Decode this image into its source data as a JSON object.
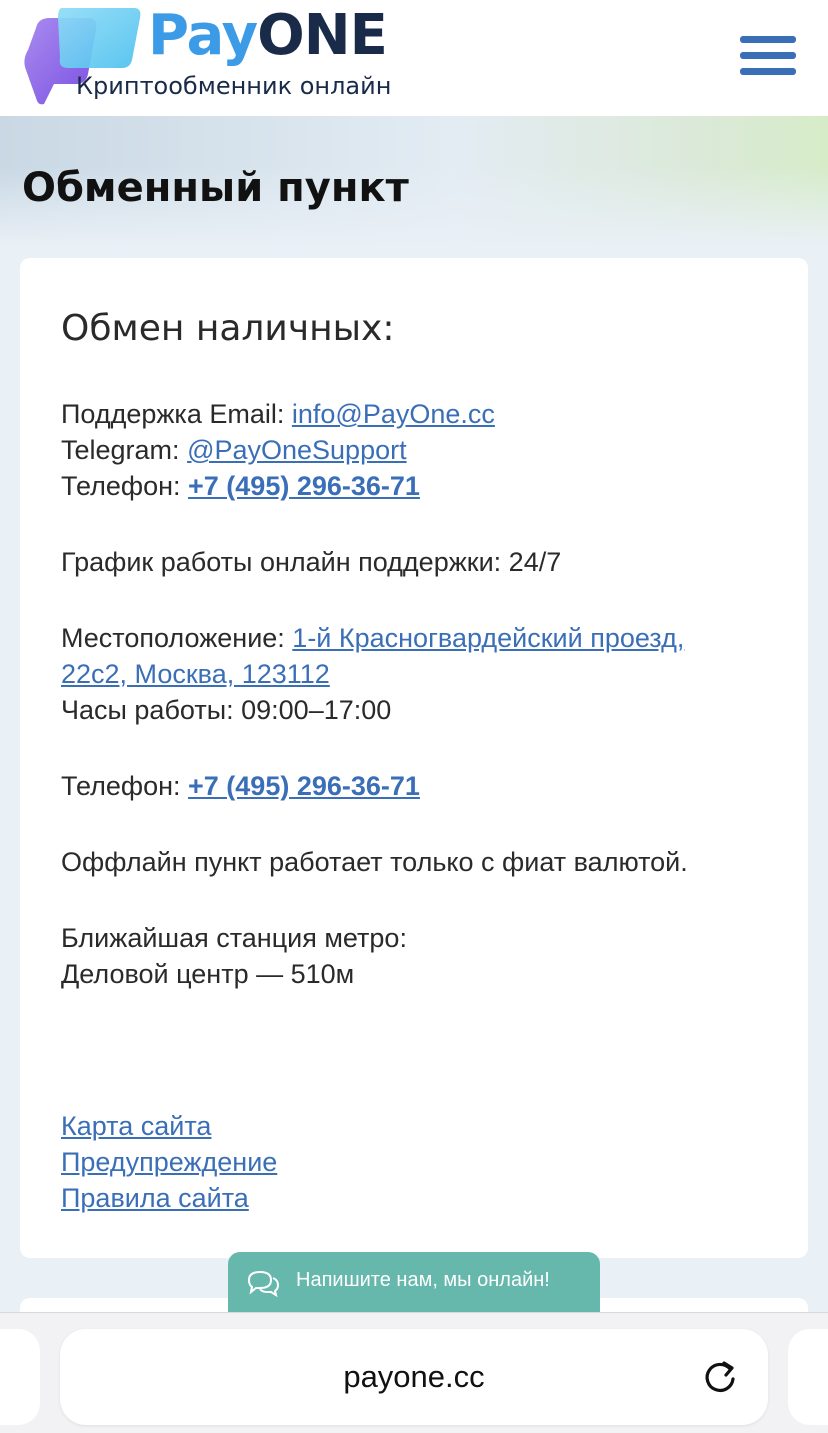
{
  "header": {
    "brand_pay": "Pay",
    "brand_one": "ONE",
    "subtitle": "Криптообменник онлайн",
    "menu_icon": "hamburger-menu-icon"
  },
  "page": {
    "title": "Обменный пункт"
  },
  "card": {
    "title": "Обмен наличных:",
    "support_email_label": "Поддержка Email: ",
    "support_email": "info@PayOne.cc",
    "telegram_label": "Telegram: ",
    "telegram": "@PayOneSupport",
    "phone_label": "Телефон: ",
    "phone": "+7 (495) 296-36-71",
    "schedule_text": "График работы онлайн поддержки: 24/7",
    "location_label": "Местоположение: ",
    "location_line1": "1-й Красногвардейский проезд,",
    "location_line2": "22с2, Москва, 123112",
    "hours_label": "Часы работы: ",
    "hours_value": "09:00–17:00",
    "phone2_label": "Телефон: ",
    "phone2": "+7 (495) 296-36-71",
    "offline_note": "Оффлайн пункт работает только с фиат валютой.",
    "metro_label": "Ближайшая станция метро:",
    "metro_value": "Деловой центр — 510м",
    "footer_links": [
      "Карта сайта",
      "Предупреждение",
      "Правила сайта"
    ]
  },
  "chat": {
    "label": "Напишите нам, мы онлайн!",
    "icon": "chat-bubbles-icon"
  },
  "browser": {
    "url": "payone.cc",
    "reload_icon": "reload-icon"
  },
  "colors": {
    "accent": "#3a6fb8",
    "brand_light": "#3c9be6",
    "brand_dark": "#1a2b4a",
    "chat_bg": "#66b8ad"
  }
}
